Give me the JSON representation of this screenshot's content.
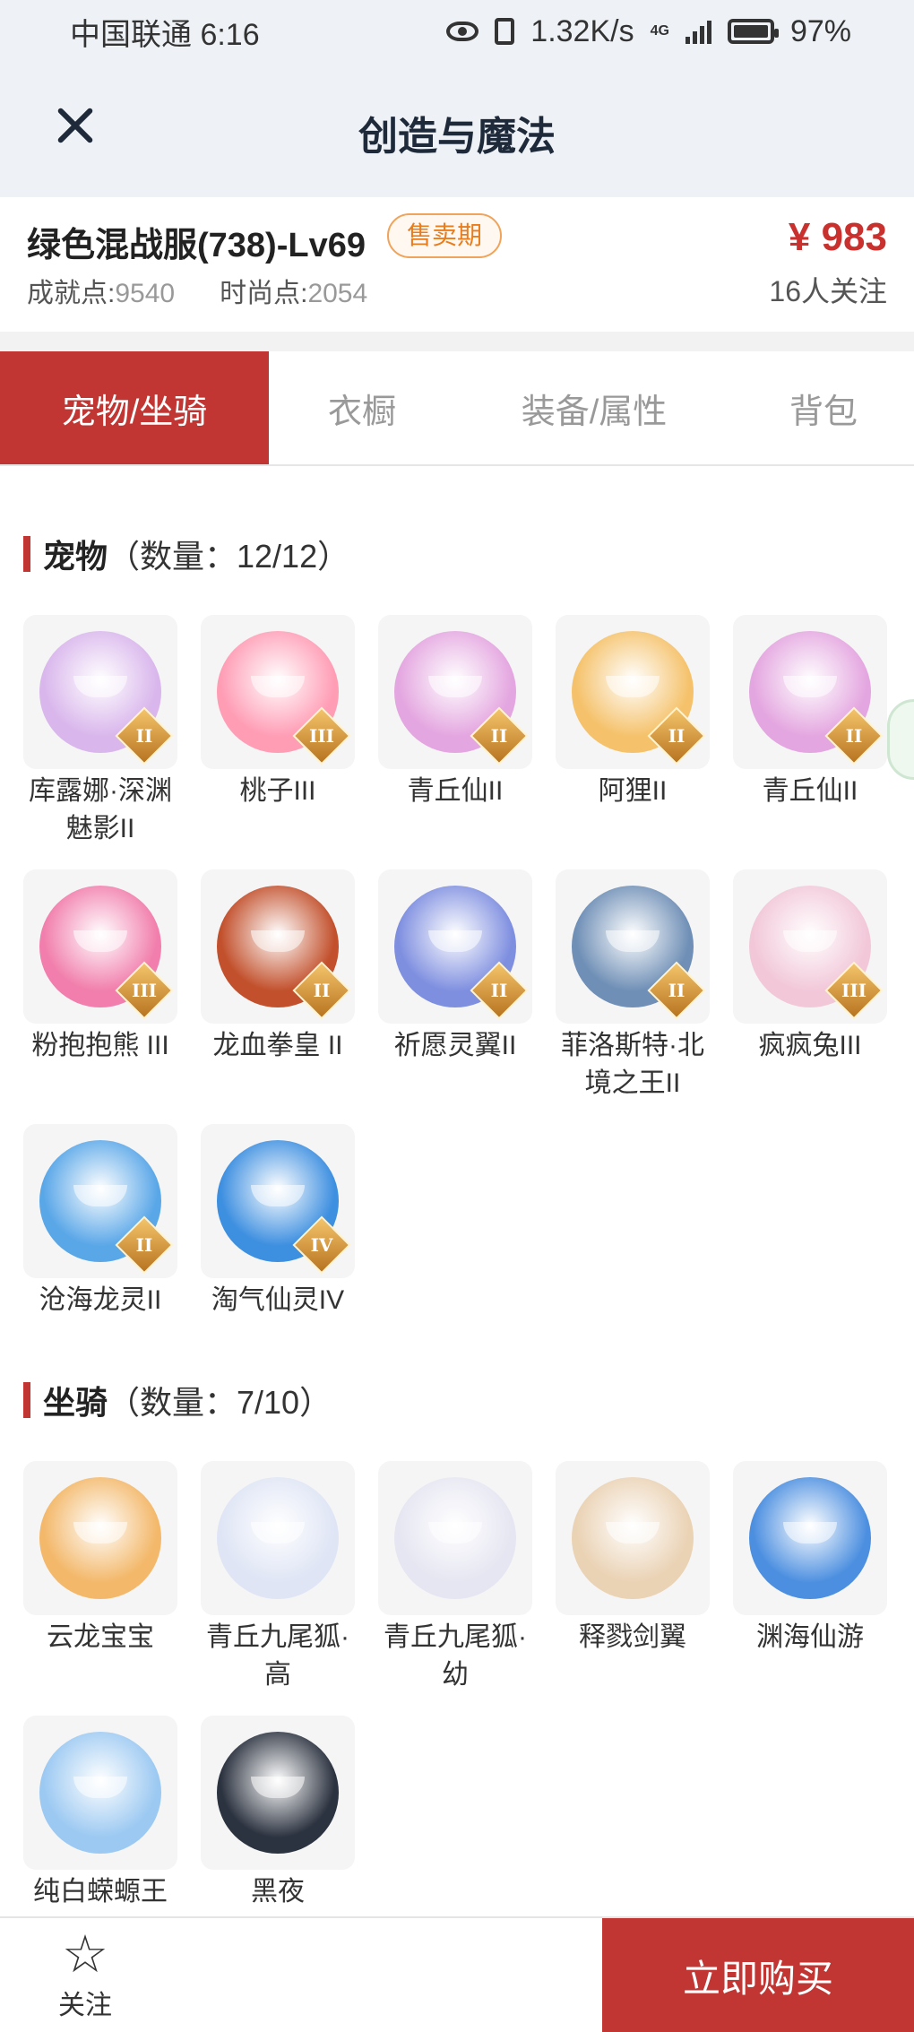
{
  "status_bar": {
    "carrier_time": "中国联通 6:16",
    "net_speed": "1.32K/s",
    "net_type": "4G",
    "battery": "97%"
  },
  "title_bar": {
    "title": "创造与魔法"
  },
  "listing": {
    "name": "绿色混战服(738)-Lv69",
    "badge": "售卖期",
    "achievement_label": "成就点:",
    "achievement_value": "9540",
    "fashion_label": "时尚点:",
    "fashion_value": "2054",
    "price": "¥ 983",
    "followers": "16人关注"
  },
  "tabs": [
    "宠物/坐骑",
    "衣橱",
    "装备/属性",
    "背包"
  ],
  "pets": {
    "title": "宠物",
    "count": "（数量：12/12）",
    "items": [
      {
        "label": "库露娜·深渊魅影II",
        "rank": "II",
        "color": "#d9b6ec"
      },
      {
        "label": "桃子III",
        "rank": "III",
        "color": "#ff9db5"
      },
      {
        "label": "青丘仙II",
        "rank": "II",
        "color": "#e4a6e0"
      },
      {
        "label": "阿狸II",
        "rank": "II",
        "color": "#f5c26b"
      },
      {
        "label": "青丘仙II",
        "rank": "II",
        "color": "#e4a6e0"
      },
      {
        "label": "粉抱抱熊 III",
        "rank": "III",
        "color": "#f17eac"
      },
      {
        "label": "龙血拳皇 II",
        "rank": "II",
        "color": "#c2502c"
      },
      {
        "label": "祈愿灵翼II",
        "rank": "II",
        "color": "#7f8fe0"
      },
      {
        "label": "菲洛斯特·北境之王II",
        "rank": "II",
        "color": "#6f8fb6"
      },
      {
        "label": "疯疯兔III",
        "rank": "III",
        "color": "#f2c8d9"
      },
      {
        "label": "沧海龙灵II",
        "rank": "II",
        "color": "#5aa7e8"
      },
      {
        "label": "淘气仙灵IV",
        "rank": "IV",
        "color": "#3d8fe0"
      }
    ]
  },
  "mounts": {
    "title": "坐骑",
    "count": "（数量：7/10）",
    "items": [
      {
        "label": "云龙宝宝",
        "color": "#f3b86a"
      },
      {
        "label": "青丘九尾狐·高",
        "color": "#dfe5f5"
      },
      {
        "label": "青丘九尾狐·幼",
        "color": "#e6e6f2"
      },
      {
        "label": "释戮剑翼",
        "color": "#ead2b4"
      },
      {
        "label": "渊海仙游",
        "color": "#4c8fe0"
      },
      {
        "label": "纯白蝾螈王",
        "color": "#9cc9f2"
      },
      {
        "label": "黑夜",
        "color": "#2c3340"
      }
    ]
  },
  "bottom_bar": {
    "follow_label": "关注",
    "buy_label": "立即购买"
  }
}
